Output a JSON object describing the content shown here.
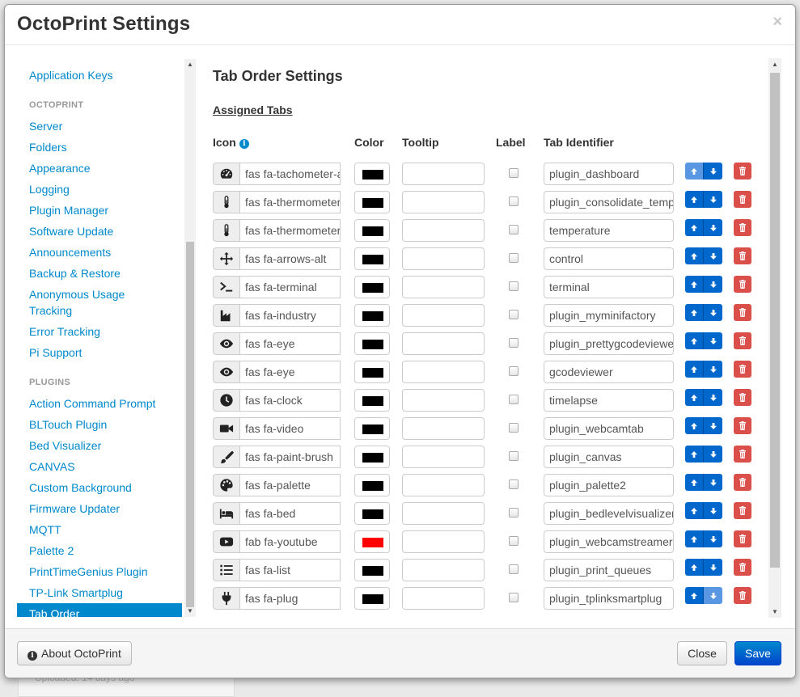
{
  "dialog": {
    "title": "OctoPrint Settings",
    "close_glyph": "×",
    "background_peek": "Uploaded: 14 days ago"
  },
  "sidebar": {
    "items": [
      {
        "type": "item",
        "label": "Application Keys"
      },
      {
        "type": "header",
        "label": "OCTOPRINT"
      },
      {
        "type": "item",
        "label": "Server"
      },
      {
        "type": "item",
        "label": "Folders"
      },
      {
        "type": "item",
        "label": "Appearance"
      },
      {
        "type": "item",
        "label": "Logging"
      },
      {
        "type": "item",
        "label": "Plugin Manager"
      },
      {
        "type": "item",
        "label": "Software Update"
      },
      {
        "type": "item",
        "label": "Announcements"
      },
      {
        "type": "item",
        "label": "Backup & Restore"
      },
      {
        "type": "item",
        "label": "Anonymous Usage Tracking",
        "lines": [
          "Anonymous Usage",
          "Tracking"
        ]
      },
      {
        "type": "item",
        "label": "Error Tracking"
      },
      {
        "type": "item",
        "label": "Pi Support"
      },
      {
        "type": "header",
        "label": "PLUGINS"
      },
      {
        "type": "item",
        "label": "Action Command Prompt"
      },
      {
        "type": "item",
        "label": "BLTouch Plugin"
      },
      {
        "type": "item",
        "label": "Bed Visualizer"
      },
      {
        "type": "item",
        "label": "CANVAS"
      },
      {
        "type": "item",
        "label": "Custom Background"
      },
      {
        "type": "item",
        "label": "Firmware Updater"
      },
      {
        "type": "item",
        "label": "MQTT"
      },
      {
        "type": "item",
        "label": "Palette 2"
      },
      {
        "type": "item",
        "label": "PrintTimeGenius Plugin"
      },
      {
        "type": "item",
        "label": "TP-Link Smartplug"
      },
      {
        "type": "item",
        "label": "Tab Order",
        "active": true
      }
    ]
  },
  "main": {
    "title": "Tab Order Settings",
    "subtitle": "Assigned Tabs",
    "columns": {
      "icon": "Icon",
      "icon_info": "i",
      "color": "Color",
      "tooltip": "Tooltip",
      "label": "Label",
      "identifier": "Tab Identifier"
    },
    "rows": [
      {
        "icon": "tachometer-icon",
        "icon_class": "fas fa-tachometer-alt",
        "color": "#000000",
        "tooltip": "",
        "label_checked": false,
        "identifier": "plugin_dashboard",
        "up_disabled": true,
        "down_disabled": false
      },
      {
        "icon": "thermometer-icon",
        "icon_class": "fas fa-thermometer-half",
        "color": "#000000",
        "tooltip": "",
        "label_checked": false,
        "identifier": "plugin_consolidate_temp_control",
        "up_disabled": false,
        "down_disabled": false
      },
      {
        "icon": "thermometer-icon",
        "icon_class": "fas fa-thermometer-half",
        "color": "#000000",
        "tooltip": "",
        "label_checked": false,
        "identifier": "temperature",
        "up_disabled": false,
        "down_disabled": false
      },
      {
        "icon": "arrows-alt-icon",
        "icon_class": "fas fa-arrows-alt",
        "color": "#000000",
        "tooltip": "",
        "label_checked": false,
        "identifier": "control",
        "up_disabled": false,
        "down_disabled": false
      },
      {
        "icon": "terminal-icon",
        "icon_class": "fas fa-terminal",
        "color": "#000000",
        "tooltip": "",
        "label_checked": false,
        "identifier": "terminal",
        "up_disabled": false,
        "down_disabled": false
      },
      {
        "icon": "industry-icon",
        "icon_class": "fas fa-industry",
        "color": "#000000",
        "tooltip": "",
        "label_checked": false,
        "identifier": "plugin_myminifactory",
        "up_disabled": false,
        "down_disabled": false
      },
      {
        "icon": "eye-icon",
        "icon_class": "fas fa-eye",
        "color": "#000000",
        "tooltip": "",
        "label_checked": false,
        "identifier": "plugin_prettygcodeviewer",
        "up_disabled": false,
        "down_disabled": false
      },
      {
        "icon": "eye-icon",
        "icon_class": "fas fa-eye",
        "color": "#000000",
        "tooltip": "",
        "label_checked": false,
        "identifier": "gcodeviewer",
        "up_disabled": false,
        "down_disabled": false
      },
      {
        "icon": "clock-icon",
        "icon_class": "fas fa-clock",
        "color": "#000000",
        "tooltip": "",
        "label_checked": false,
        "identifier": "timelapse",
        "up_disabled": false,
        "down_disabled": false
      },
      {
        "icon": "video-icon",
        "icon_class": "fas fa-video",
        "color": "#000000",
        "tooltip": "",
        "label_checked": false,
        "identifier": "plugin_webcamtab",
        "up_disabled": false,
        "down_disabled": false
      },
      {
        "icon": "paint-brush-icon",
        "icon_class": "fas fa-paint-brush",
        "color": "#000000",
        "tooltip": "",
        "label_checked": false,
        "identifier": "plugin_canvas",
        "up_disabled": false,
        "down_disabled": false
      },
      {
        "icon": "palette-icon",
        "icon_class": "fas fa-palette",
        "color": "#000000",
        "tooltip": "",
        "label_checked": false,
        "identifier": "plugin_palette2",
        "up_disabled": false,
        "down_disabled": false
      },
      {
        "icon": "bed-icon",
        "icon_class": "fas fa-bed",
        "color": "#000000",
        "tooltip": "",
        "label_checked": false,
        "identifier": "plugin_bedlevelvisualizer",
        "up_disabled": false,
        "down_disabled": false
      },
      {
        "icon": "youtube-icon",
        "icon_class": "fab fa-youtube",
        "color": "#ff0000",
        "tooltip": "",
        "label_checked": false,
        "identifier": "plugin_webcamstreamer",
        "up_disabled": false,
        "down_disabled": false
      },
      {
        "icon": "list-icon",
        "icon_class": "fas fa-list",
        "color": "#000000",
        "tooltip": "",
        "label_checked": false,
        "identifier": "plugin_print_queues",
        "up_disabled": false,
        "down_disabled": false
      },
      {
        "icon": "plug-icon",
        "icon_class": "fas fa-plug",
        "color": "#000000",
        "tooltip": "",
        "label_checked": false,
        "identifier": "plugin_tplinksmartplug",
        "up_disabled": false,
        "down_disabled": true
      }
    ]
  },
  "footer": {
    "about_label": "About OctoPrint",
    "about_icon": "i",
    "close_label": "Close",
    "save_label": "Save"
  },
  "colors": {
    "accent": "#0088cc",
    "button_primary": "#0068cc",
    "button_danger": "#da4f49"
  }
}
